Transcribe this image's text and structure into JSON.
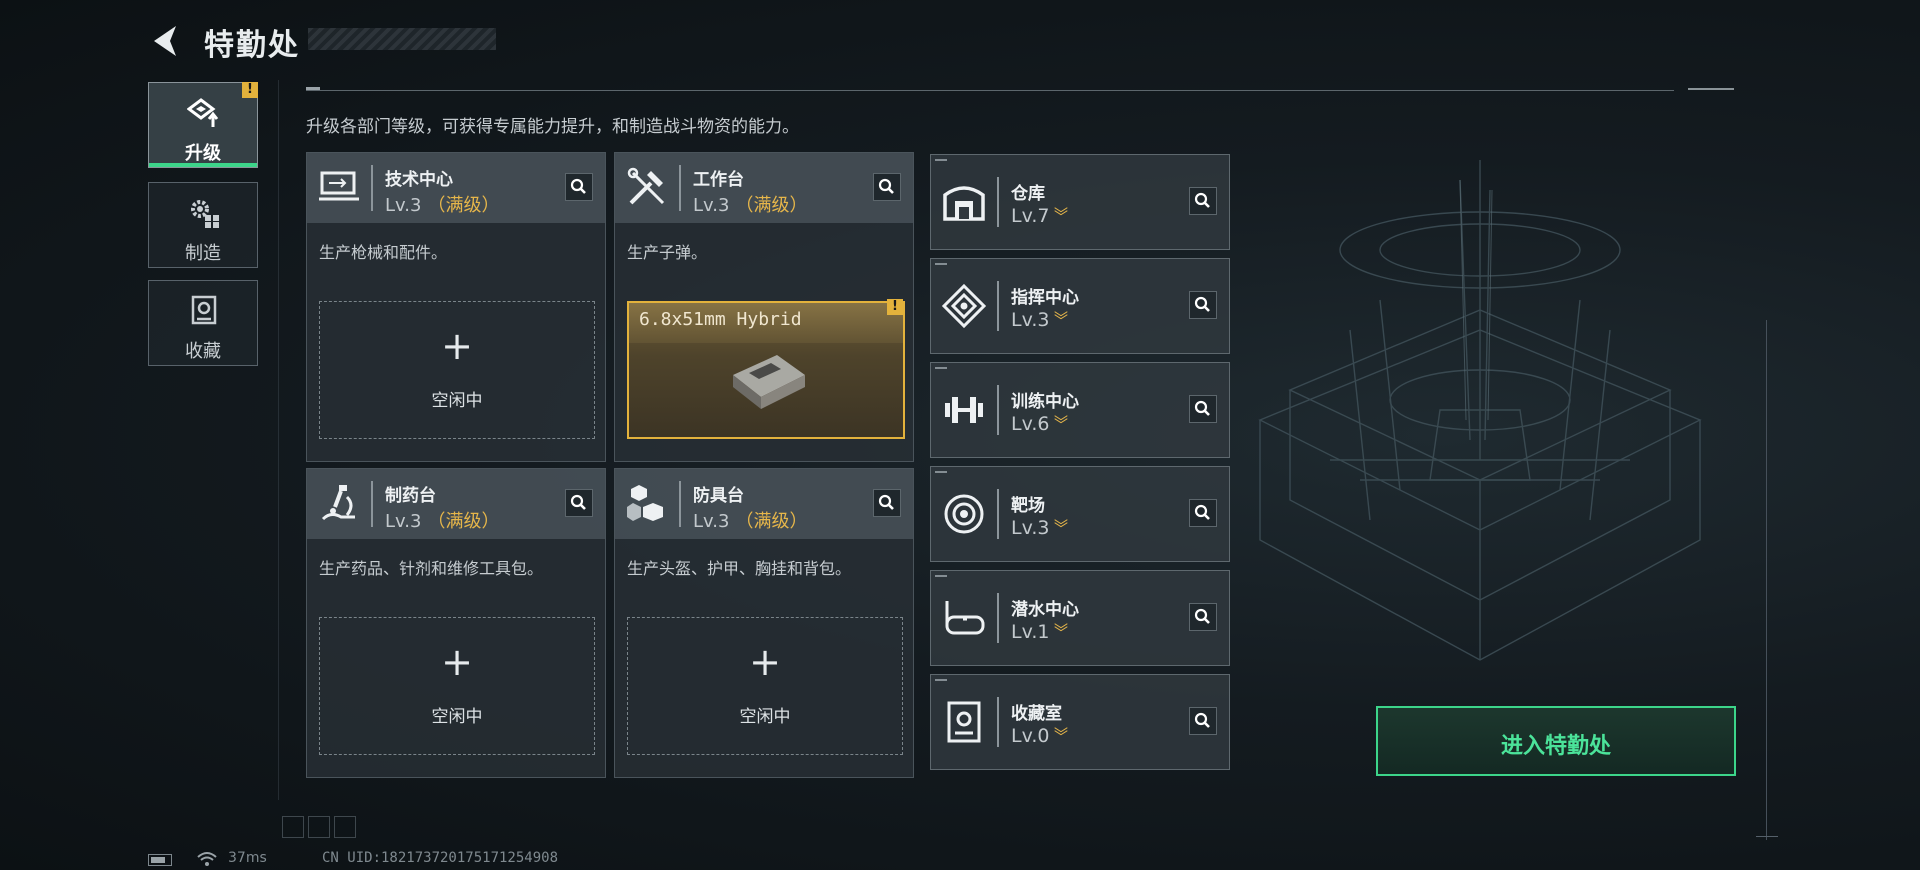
{
  "header": {
    "title": "特勤处"
  },
  "description": "升级各部门等级，可获得专属能力提升，和制造战斗物资的能力。",
  "sidebar": {
    "tabs": [
      {
        "label": "升级",
        "icon": "upgrade-icon",
        "active": true,
        "warning": "!"
      },
      {
        "label": "制造",
        "icon": "gears-icon",
        "active": false
      },
      {
        "label": "收藏",
        "icon": "collection-icon",
        "active": false
      }
    ]
  },
  "departments": [
    {
      "name": "技术中心",
      "level": "Lv.3",
      "max": "（满级）",
      "desc": "生产枪械和配件。",
      "slot": {
        "state": "idle",
        "label": "空闲中"
      },
      "icon": "tech-center-icon"
    },
    {
      "name": "工作台",
      "level": "Lv.3",
      "max": "（满级）",
      "desc": "生产子弹。",
      "slot": {
        "state": "producing",
        "item": "6.8x51mm Hybrid",
        "warning": "!"
      },
      "icon": "workbench-icon"
    },
    {
      "name": "制药台",
      "level": "Lv.3",
      "max": "（满级）",
      "desc": "生产药品、针剂和维修工具包。",
      "slot": {
        "state": "idle",
        "label": "空闲中"
      },
      "icon": "pharmacy-icon"
    },
    {
      "name": "防具台",
      "level": "Lv.3",
      "max": "（满级）",
      "desc": "生产头盔、护甲、胸挂和背包。",
      "slot": {
        "state": "idle",
        "label": "空闲中"
      },
      "icon": "armor-bench-icon"
    }
  ],
  "facilities": [
    {
      "name": "仓库",
      "level": "Lv.7",
      "icon": "warehouse-icon"
    },
    {
      "name": "指挥中心",
      "level": "Lv.3",
      "icon": "command-center-icon"
    },
    {
      "name": "训练中心",
      "level": "Lv.6",
      "icon": "training-center-icon"
    },
    {
      "name": "靶场",
      "level": "Lv.3",
      "icon": "shooting-range-icon"
    },
    {
      "name": "潜水中心",
      "level": "Lv.1",
      "icon": "diving-center-icon"
    },
    {
      "name": "收藏室",
      "level": "Lv.0",
      "icon": "collection-room-icon"
    }
  ],
  "enter_button": "进入特勤处",
  "footer": {
    "ping": "37ms",
    "uid": "CN UID:1821737201751712549​08"
  },
  "colors": {
    "accent_green": "#3cd58a",
    "gold": "#e6b64a",
    "warning": "#e3b23c"
  }
}
